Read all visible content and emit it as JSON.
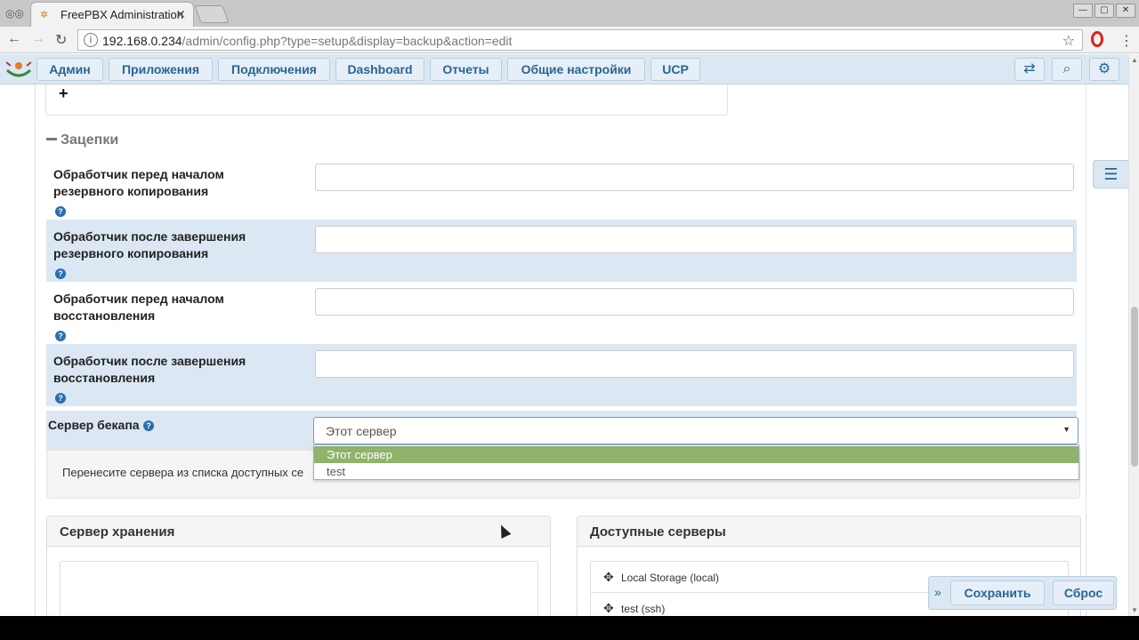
{
  "browser": {
    "tab_title": "FreePBX Administration",
    "tab_close": "✕",
    "url_host": "192.168.0.234",
    "url_path": "/admin/config.php?type=setup&display=backup&action=edit",
    "win_min": "—",
    "win_max": "▢",
    "win_close": "✕"
  },
  "nav": {
    "items": [
      "Админ",
      "Приложения",
      "Подключения",
      "Dashboard",
      "Отчеты",
      "Общие настройки",
      "UCP"
    ]
  },
  "hooks": {
    "section_title": "Зацепки",
    "rows": [
      {
        "label": "Обработчик перед началом резервного копирования",
        "value": ""
      },
      {
        "label": "Обработчик после завершения резервного копирования",
        "value": ""
      },
      {
        "label": "Обработчик перед началом восстановления",
        "value": ""
      },
      {
        "label": "Обработчик после завершения восстановления",
        "value": ""
      }
    ]
  },
  "backup_server": {
    "label": "Сервер бекапа",
    "selected": "Этот сервер",
    "options": [
      "Этот сервер",
      "test"
    ]
  },
  "info": {
    "text": "Перенесите сервера из списка доступных се"
  },
  "storage_panel": {
    "title": "Сервер хранения"
  },
  "available_panel": {
    "title": "Доступные серверы",
    "servers": [
      "Local Storage (local)",
      "test (ssh)"
    ]
  },
  "actions": {
    "save": "Сохранить",
    "reset": "Сброс"
  },
  "misc": {
    "plus": "+",
    "help": "?"
  }
}
